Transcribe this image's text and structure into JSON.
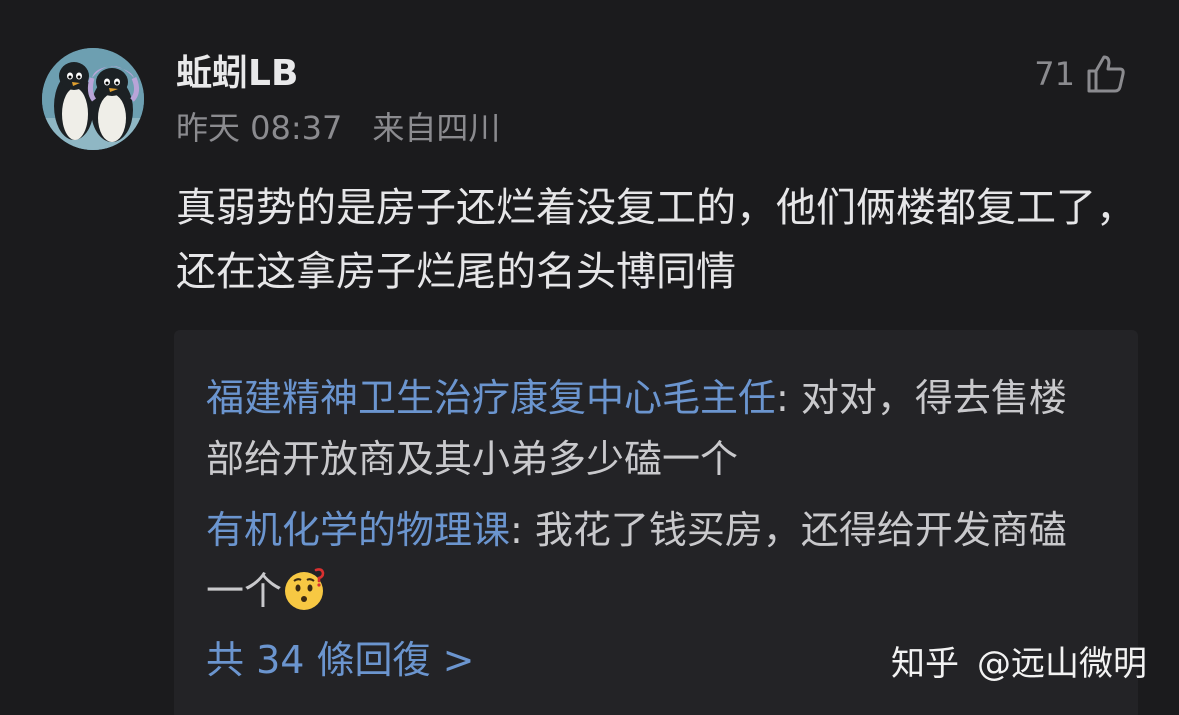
{
  "comment": {
    "author": "蚯蚓LB",
    "time": "昨天 08:37",
    "location": "来自四川",
    "like_count": "71",
    "text": "真弱势的是房子还烂着没复工的，他们俩楼都复工了，还在这拿房子烂尾的名头博同情"
  },
  "replies": [
    {
      "author": "福建精神卫生治疗康复中心毛主任",
      "separator": ": ",
      "text": "对对，得去售楼部给开放商及其小弟多少磕一个"
    },
    {
      "author": "有机化学的物理课",
      "separator": ": ",
      "text": "我花了钱买房，还得给开发商磕一个",
      "emoji": "thinking-face-emoji"
    }
  ],
  "more_replies": "共 34 條回復 >",
  "watermark": {
    "brand": "知乎",
    "account": "@远山微明"
  },
  "colors": {
    "background": "#1b1b1d",
    "reply_box": "#232326",
    "link_blue": "#6b95cf",
    "muted_gray": "#8b8b8f"
  },
  "icons": [
    "avatar-penguins",
    "thumbs-up-icon",
    "thinking-face-emoji"
  ]
}
